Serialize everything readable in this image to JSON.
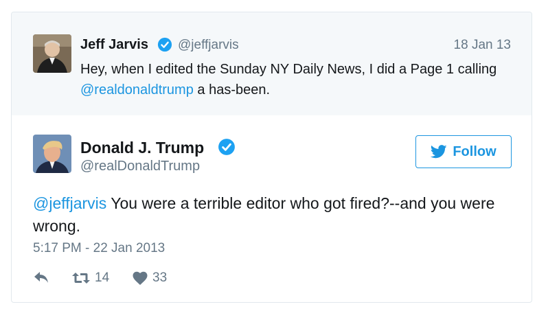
{
  "quoted_tweet": {
    "name": "Jeff Jarvis",
    "handle": "@jeffjarvis",
    "date": "18 Jan 13",
    "text_before": "Hey, when I edited the Sunday NY Daily News, I did a Page 1 calling ",
    "mention": "@realdonaldtrump",
    "text_after": " a has-been."
  },
  "main_tweet": {
    "name": "Donald J. Trump",
    "handle": "@realDonaldTrump",
    "follow_label": "Follow",
    "mention": "@jeffjarvis",
    "text": " You were a terrible editor who got fired?--and you were wrong.",
    "timestamp": "5:17 PM - 22 Jan 2013",
    "retweets": "14",
    "likes": "33"
  },
  "colors": {
    "accent": "#1b95e0",
    "muted": "#657786",
    "quoted_bg": "#f5f8fa"
  },
  "icons": [
    "verified-badge-icon",
    "bird-icon",
    "reply-icon",
    "retweet-icon",
    "heart-icon"
  ]
}
